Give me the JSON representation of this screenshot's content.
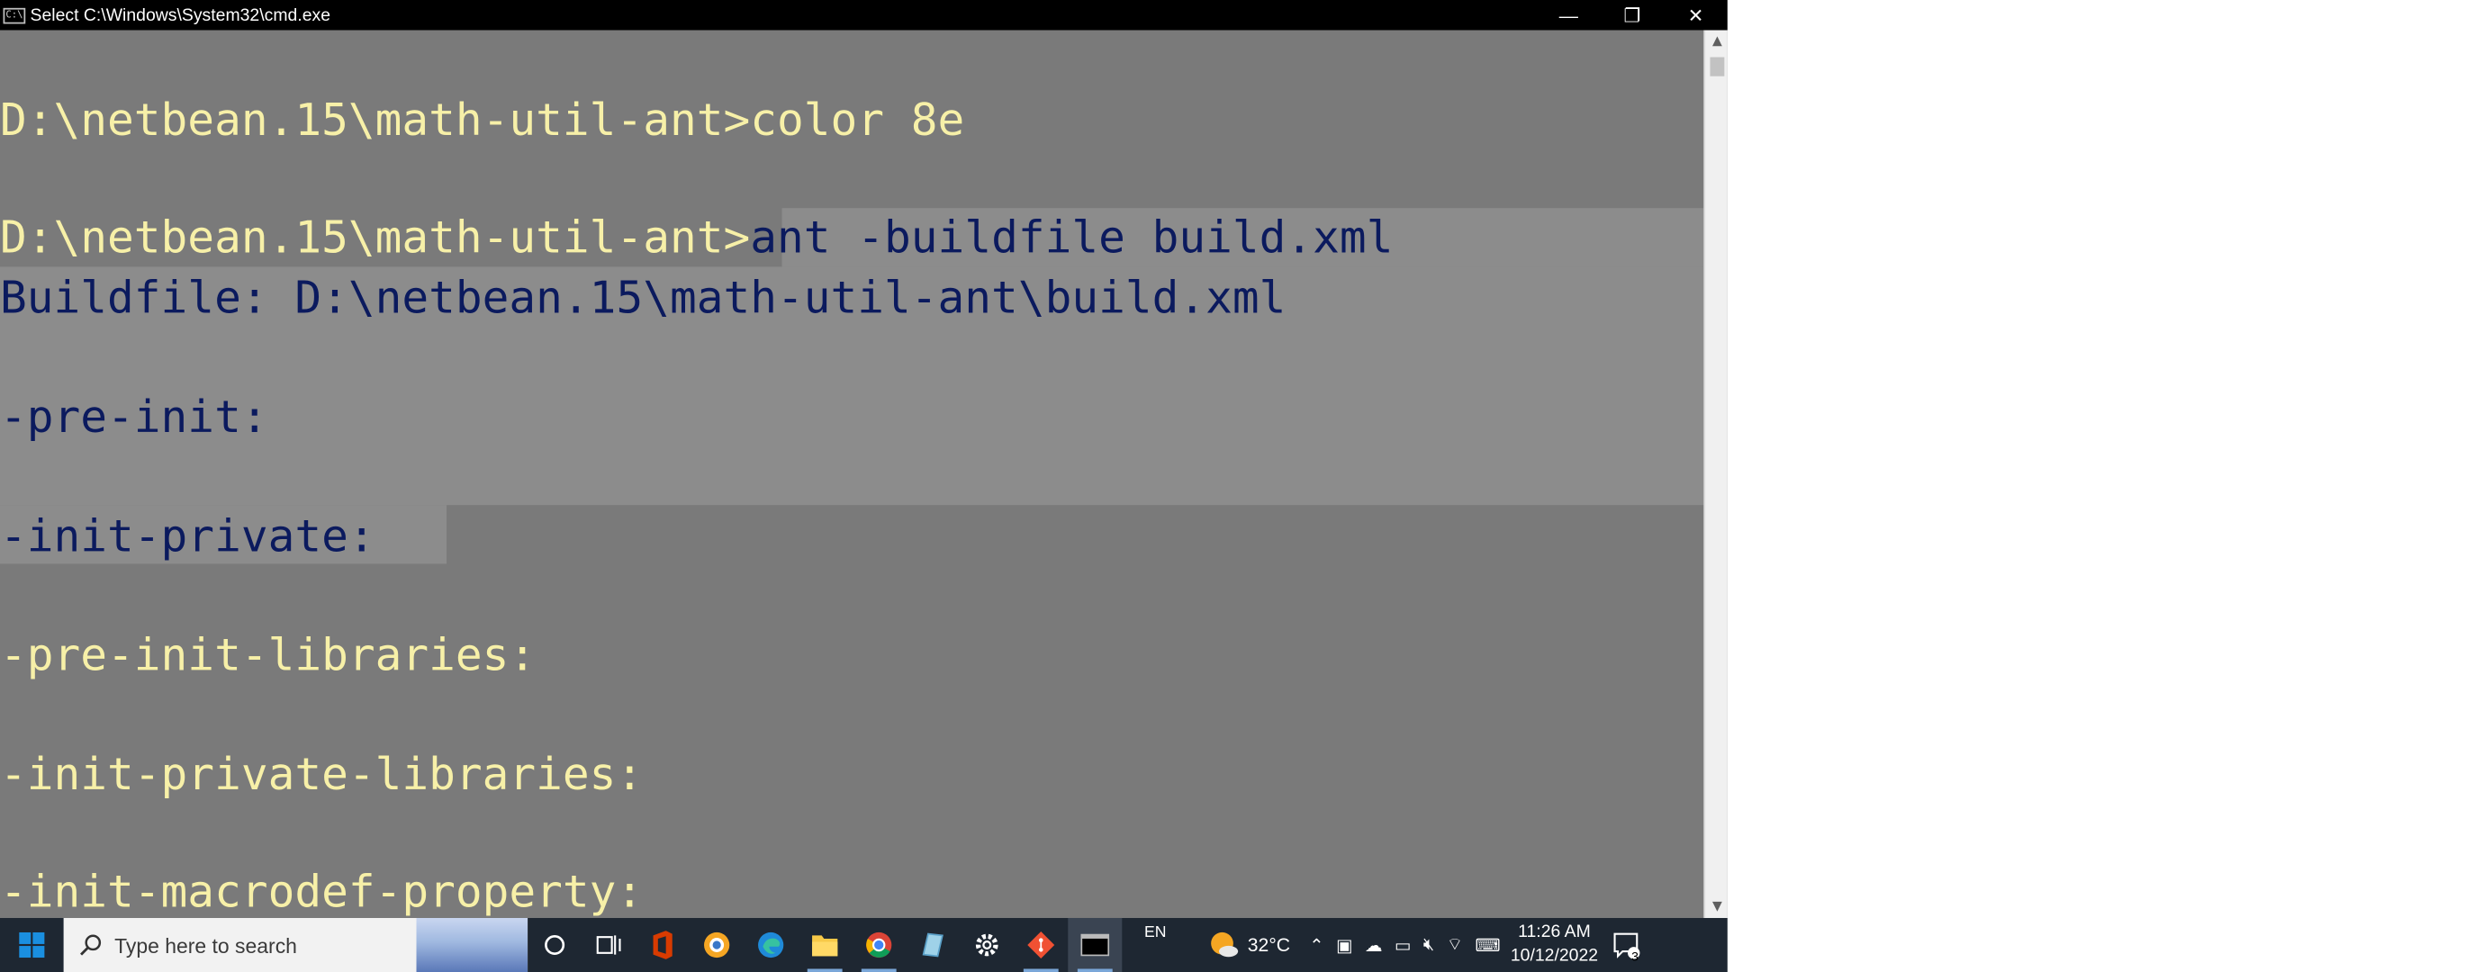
{
  "window": {
    "title": "Select C:\\Windows\\System32\\cmd.exe",
    "minimize": "—",
    "restore": "❐",
    "close": "✕"
  },
  "console": {
    "lines": [
      {
        "prompt": "D:\\netbean.15\\math-util-ant>",
        "cmd": "color 8e"
      },
      {
        "prompt": "D:\\netbean.15\\math-util-ant>",
        "cmd": "ant -buildfile build.xml"
      },
      {
        "text": "Buildfile: D:\\netbean.15\\math-util-ant\\build.xml"
      },
      {
        "text": "-pre-init:"
      },
      {
        "text": "-init-private:"
      },
      {
        "text": "-pre-init-libraries:"
      },
      {
        "text": "-init-private-libraries:"
      },
      {
        "text": "-init-macrodef-property:"
      }
    ]
  },
  "taskbar": {
    "search_placeholder": "Type here to search",
    "language": "EN",
    "temperature": "32°C",
    "time": "11:26 AM",
    "date": "10/12/2022",
    "notification_count": "3"
  },
  "colors": {
    "console_bg": "#7a7a7a",
    "console_fg": "#f7f0a8",
    "selection_fg": "#0b1a5e",
    "selection_bg": "#8c8c8c"
  }
}
